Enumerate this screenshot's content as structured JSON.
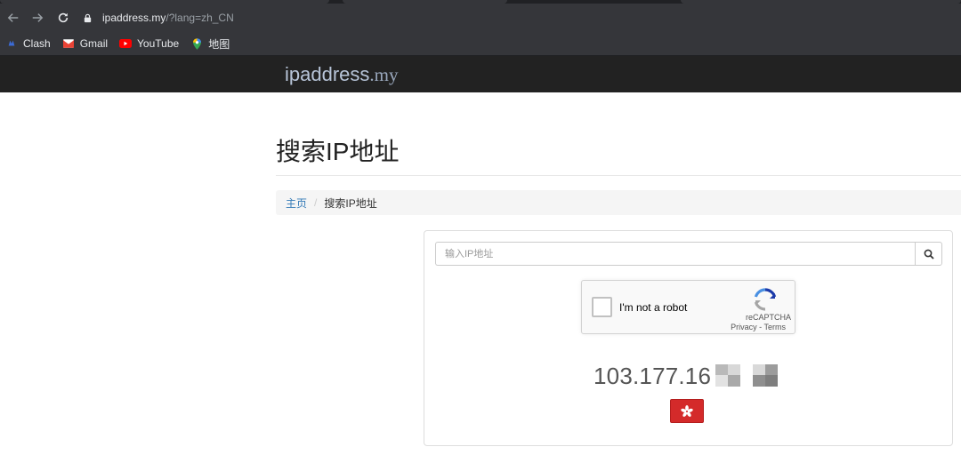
{
  "browser": {
    "url_host": "ipaddress.my",
    "url_rest": "/?lang=zh_CN",
    "bookmarks": [
      {
        "label": "Clash",
        "icon": "clash-icon"
      },
      {
        "label": "Gmail",
        "icon": "gmail-icon"
      },
      {
        "label": "YouTube",
        "icon": "youtube-icon"
      },
      {
        "label": "地图",
        "icon": "maps-icon"
      }
    ]
  },
  "site": {
    "brand_name": "ipaddress",
    "brand_tld": ".my"
  },
  "page": {
    "title": "搜索IP地址",
    "breadcrumb": {
      "home": "主页",
      "separator": "/",
      "current": "搜索IP地址"
    }
  },
  "search": {
    "placeholder": "输入IP地址",
    "value": ""
  },
  "recaptcha": {
    "label": "I'm not a robot",
    "brand": "reCAPTCHA",
    "links": "Privacy - Terms"
  },
  "result": {
    "ip_visible": "103.177.16",
    "country_flag": "hong-kong-flag-icon"
  },
  "colors": {
    "header_bg": "#222222",
    "link": "#337ab7",
    "flag_red": "#d42a2a"
  }
}
